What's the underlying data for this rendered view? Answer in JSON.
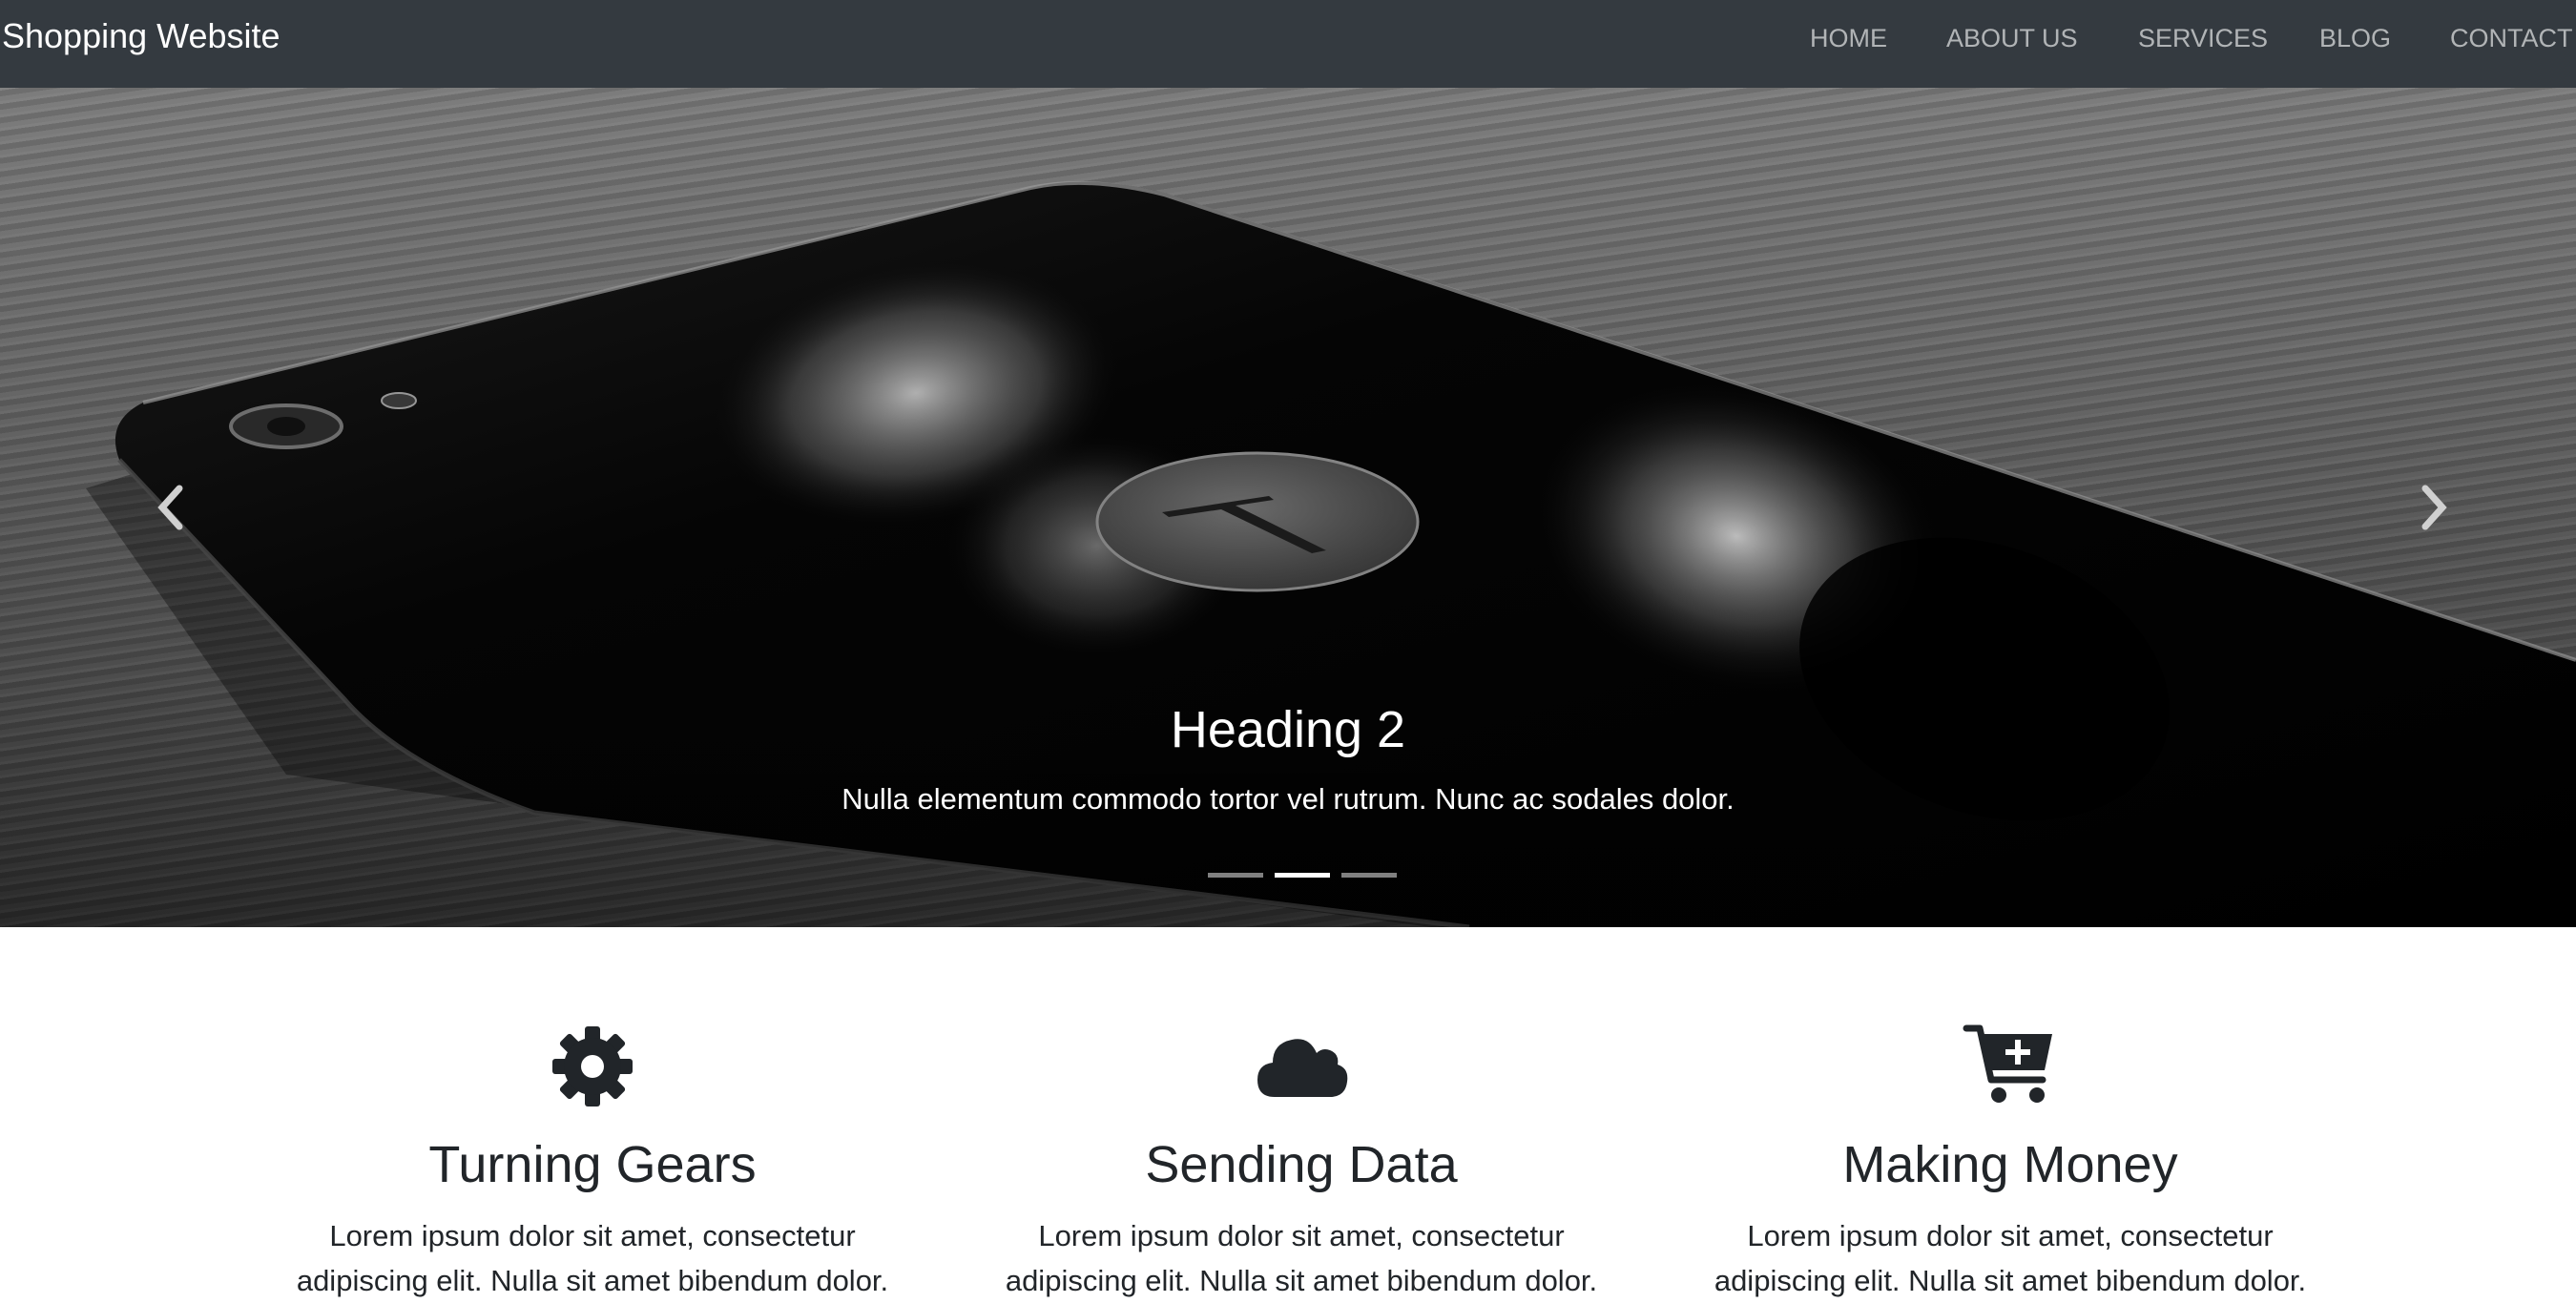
{
  "navbar": {
    "brand": "Shopping Website",
    "links": [
      "HOME",
      "ABOUT US",
      "SERVICES",
      "BLOG",
      "CONTACT"
    ]
  },
  "carousel": {
    "heading": "Heading 2",
    "text": "Nulla elementum commodo tortor vel rutrum. Nunc ac sodales dolor.",
    "slide_count": 3,
    "active_index": 1,
    "prev_icon": "chevron-left-icon",
    "next_icon": "chevron-right-icon"
  },
  "features": [
    {
      "icon": "gear-icon",
      "title": "Turning Gears",
      "text": "Lorem ipsum dolor sit amet, consectetur adipiscing elit. Nulla sit amet bibendum dolor."
    },
    {
      "icon": "cloud-icon",
      "title": "Sending Data",
      "text": "Lorem ipsum dolor sit amet, consectetur adipiscing elit. Nulla sit amet bibendum dolor."
    },
    {
      "icon": "cart-plus-icon",
      "title": "Making Money",
      "text": "Lorem ipsum dolor sit amet, consectetur adipiscing elit. Nulla sit amet bibendum dolor."
    }
  ],
  "colors": {
    "navbar_bg": "#343a40",
    "text_dark": "#212529",
    "nav_link": "rgba(255,255,255,0.62)"
  }
}
